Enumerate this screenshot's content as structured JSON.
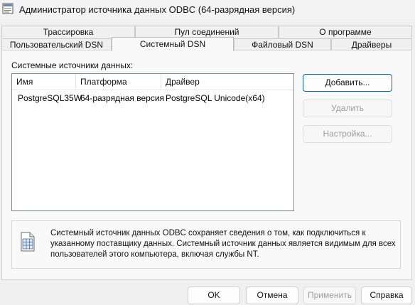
{
  "window": {
    "title": "Администратор источника данных ODBC (64-разрядная версия)"
  },
  "tabs_back": [
    "Трассировка",
    "Пул соединений",
    "О программе"
  ],
  "tabs_front": [
    "Пользовательский DSN",
    "Системный DSN",
    "Файловый DSN",
    "Драйверы"
  ],
  "active_tab": "Системный DSN",
  "group_label": "Системные источники данных:",
  "table": {
    "columns": [
      "Имя",
      "Платформа",
      "Драйвер"
    ],
    "rows": [
      [
        "PostgreSQL35W",
        "64-разрядная версия",
        "PostgreSQL Unicode(x64)"
      ]
    ]
  },
  "side_buttons": {
    "add": "Добавить...",
    "remove": "Удалить",
    "configure": "Настройка..."
  },
  "info": {
    "icon": "data-source-icon",
    "text": "Системный источник данных ODBC сохраняет сведения о том, как подключиться к указанному поставщику данных.  Системный источник данных является видимым для всех пользователей этого компьютера, включая службы NT."
  },
  "footer_buttons": {
    "ok": "OK",
    "cancel": "Отмена",
    "apply": "Применить",
    "help": "Справка"
  },
  "colors": {
    "accent": "#0067c0",
    "disabled_text": "#9d9d9d",
    "panel_bg": "#f9f9f9"
  }
}
